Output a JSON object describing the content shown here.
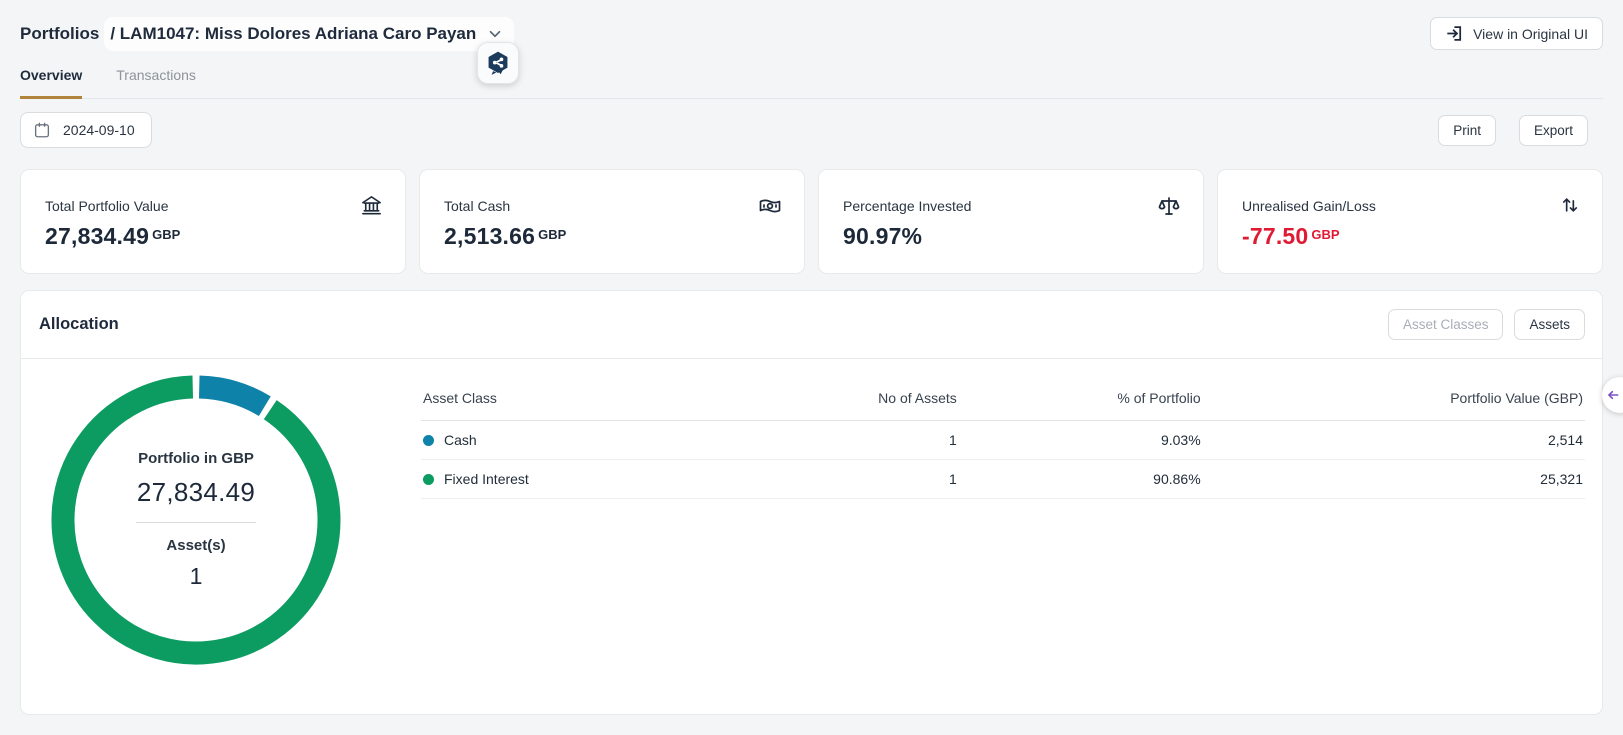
{
  "header": {
    "breadcrumb_root": "Portfolios",
    "breadcrumb_portfolio": "/ LAM1047: Miss Dolores Adriana Caro Payan",
    "view_original_label": "View in Original UI"
  },
  "tabs": [
    {
      "label": "Overview",
      "active": true
    },
    {
      "label": "Transactions",
      "active": false
    }
  ],
  "toolbar": {
    "date_value": "2024-09-10",
    "print_label": "Print",
    "export_label": "Export"
  },
  "cards": [
    {
      "label": "Total Portfolio Value",
      "value": "27,834.49",
      "unit": "GBP",
      "icon": "bank-icon"
    },
    {
      "label": "Total Cash",
      "value": "2,513.66",
      "unit": "GBP",
      "icon": "banknote-icon"
    },
    {
      "label": "Percentage Invested",
      "value": "90.97%",
      "unit": "",
      "icon": "scales-icon"
    },
    {
      "label": "Unrealised Gain/Loss",
      "value": "-77.50",
      "unit": "GBP",
      "icon": "arrows-up-down-icon",
      "negative": true
    }
  ],
  "allocation": {
    "title": "Allocation",
    "toggle_asset_classes": "Asset Classes",
    "toggle_assets": "Assets",
    "donut_center": {
      "title": "Portfolio in GBP",
      "value": "27,834.49",
      "assets_label": "Asset(s)",
      "assets_count": "1"
    },
    "table": {
      "columns": [
        "Asset Class",
        "No of Assets",
        "% of Portfolio",
        "Portfolio Value (GBP)"
      ],
      "rows": [
        {
          "asset_class": "Cash",
          "color": "#0e82a8",
          "no_of_assets": "1",
          "pct": "9.03%",
          "value": "2,514"
        },
        {
          "asset_class": "Fixed Interest",
          "color": "#0c9c61",
          "no_of_assets": "1",
          "pct": "90.86%",
          "value": "25,321"
        }
      ]
    }
  },
  "chart_data": {
    "type": "pie",
    "subtype": "donut",
    "title": "Allocation by Asset Class",
    "start": "top",
    "direction": "clockwise",
    "segments": [
      {
        "label": "Cash",
        "pct": 9.03,
        "value_gbp": 2514,
        "color": "#0e82a8"
      },
      {
        "label": "Fixed Interest",
        "pct": 90.86,
        "value_gbp": 25321,
        "color": "#0c9c61"
      }
    ],
    "center_total": 27834.49,
    "center_assets": 1
  },
  "colors": {
    "accent_gold": "#b1843c",
    "negative_red": "#e01a33",
    "green": "#0c9c61",
    "teal_blue": "#0e82a8",
    "navy_text": "#1f2b3c"
  }
}
